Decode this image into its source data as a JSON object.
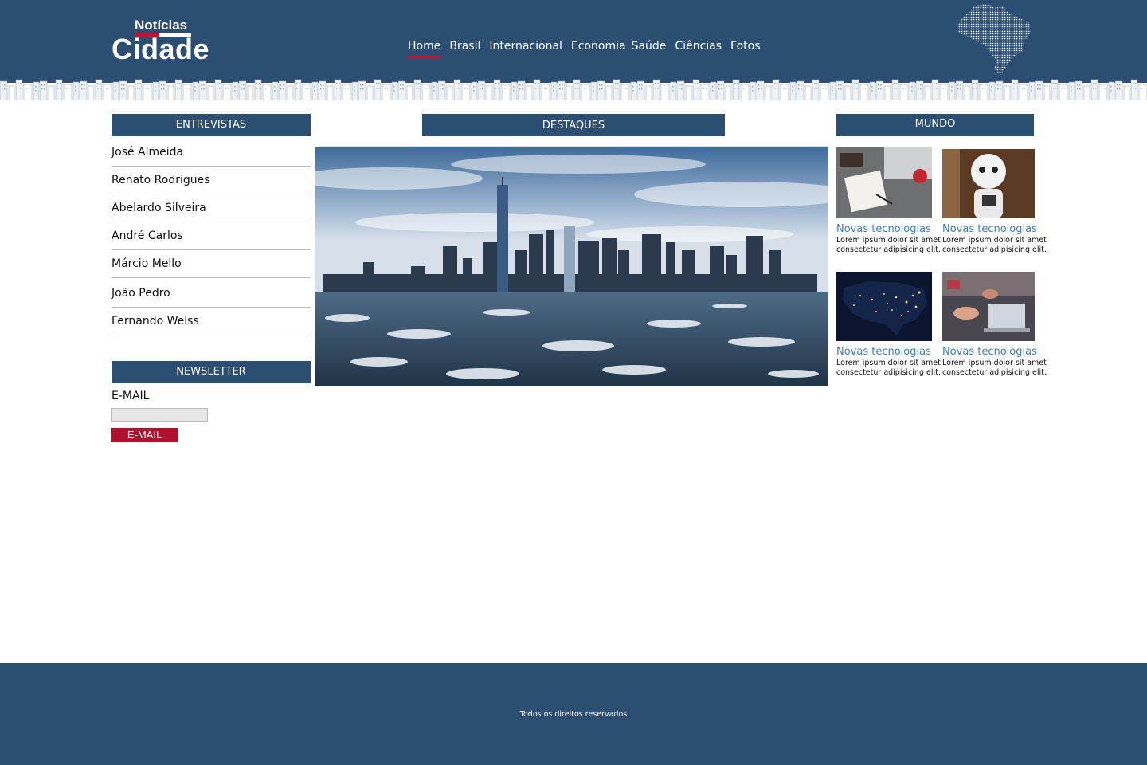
{
  "header": {
    "logo_top": "Notícias",
    "logo_main": "Cidade",
    "nav": [
      "Home",
      "Brasil",
      "Internacional",
      "Economia",
      "Saúde",
      "Ciências",
      "Fotos"
    ],
    "active_nav": "Home"
  },
  "colors": {
    "brand_blue": "#2b4e72",
    "accent_red": "#c8102e",
    "link_blue": "#3f7fc0"
  },
  "sidebar": {
    "interviews_title": "ENTREVISTAS",
    "interviews": [
      "José Almeida",
      "Renato Rodrigues",
      "Abelardo Silveira",
      "André Carlos",
      "Márcio Mello",
      "João Pedro",
      "Fernando Welss"
    ],
    "newsletter_title": "NEWSLETTER",
    "email_label": "E-MAIL",
    "email_value": "",
    "submit_label": "E-MAIL"
  },
  "main": {
    "highlights_title": "DESTAQUES"
  },
  "world": {
    "title": "MUNDO",
    "cards": [
      {
        "title": "Novas tecnologias",
        "line1": "Lorem ipsum dolor sit amet",
        "line2": "consectetur adipisicing elit."
      },
      {
        "title": "Novas tecnologias",
        "line1": "Lorem ipsum dolor sit amet",
        "line2": "consectetur adipisicing elit."
      },
      {
        "title": "Novas tecnologias",
        "line1": "Lorem ipsum dolor sit amet",
        "line2": "consectetur adipisicing elit."
      },
      {
        "title": "Novas tecnologias",
        "line1": "Lorem ipsum dolor sit amet",
        "line2": "consectetur adipisicing elit."
      }
    ]
  },
  "footer": {
    "text": "Todos os direitos reservados"
  }
}
